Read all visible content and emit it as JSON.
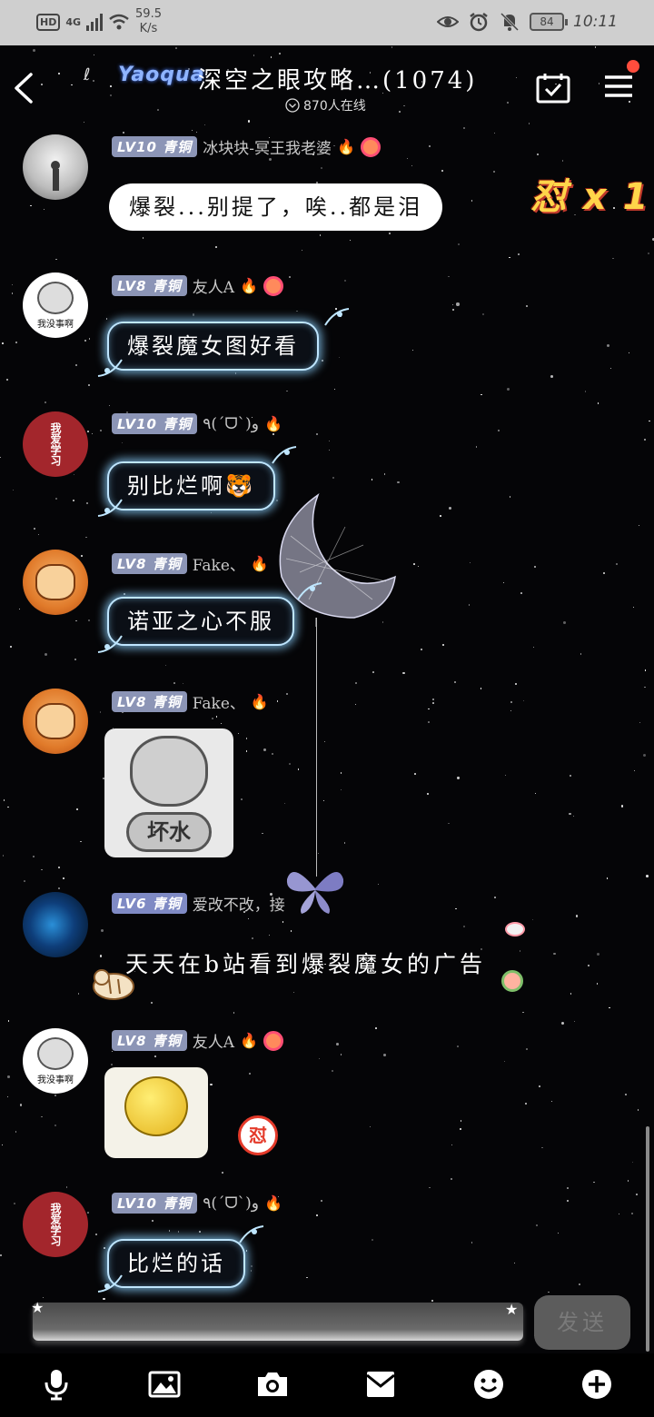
{
  "status_bar": {
    "hd": "HD",
    "network": "4G",
    "speed_value": "59.5",
    "speed_unit": "K/s",
    "battery": "84",
    "time": "10:11"
  },
  "header": {
    "logo": "Yaoqua",
    "title": "深空之眼攻略…(1074)",
    "online": "870人在线"
  },
  "effect": "怼 x 1",
  "messages": [
    {
      "level": "LV10 青铜",
      "nick": "冰块块-冥王我老婆",
      "text": "爆裂...别提了，唉..都是泪"
    },
    {
      "level": "LV8 青铜",
      "nick": "友人A",
      "text": "爆裂魔女图好看",
      "avatar_text": "我没事啊"
    },
    {
      "level": "LV10 青铜",
      "nick": "٩(ˊᗜˋ)و",
      "text": "别比烂啊",
      "avatar_text": "我爱学习"
    },
    {
      "level": "LV8 青铜",
      "nick": "Fake、",
      "text": "诺亚之心不服"
    },
    {
      "level": "LV8 青铜",
      "nick": "Fake、",
      "sticker_text": "坏水"
    },
    {
      "level": "LV6 青铜",
      "nick": "爱改不改，接",
      "text": "天天在b站看到爆裂魔女的广告"
    },
    {
      "level": "LV8 青铜",
      "nick": "友人A",
      "avatar_text": "我没事啊",
      "badge": "怼"
    },
    {
      "level": "LV10 青铜",
      "nick": "٩(ˊᗜˋ)و",
      "text": "比烂的话",
      "avatar_text": "我爱学习"
    }
  ],
  "input": {
    "send_label": "发送"
  },
  "toolbar": [
    "microphone-icon",
    "image-icon",
    "camera-icon",
    "envelope-icon",
    "emoji-icon",
    "plus-icon"
  ],
  "colors": {
    "level_badge": "#8c95b6",
    "glow": "#bfe6ff",
    "notification_dot": "#ff4d3d"
  }
}
